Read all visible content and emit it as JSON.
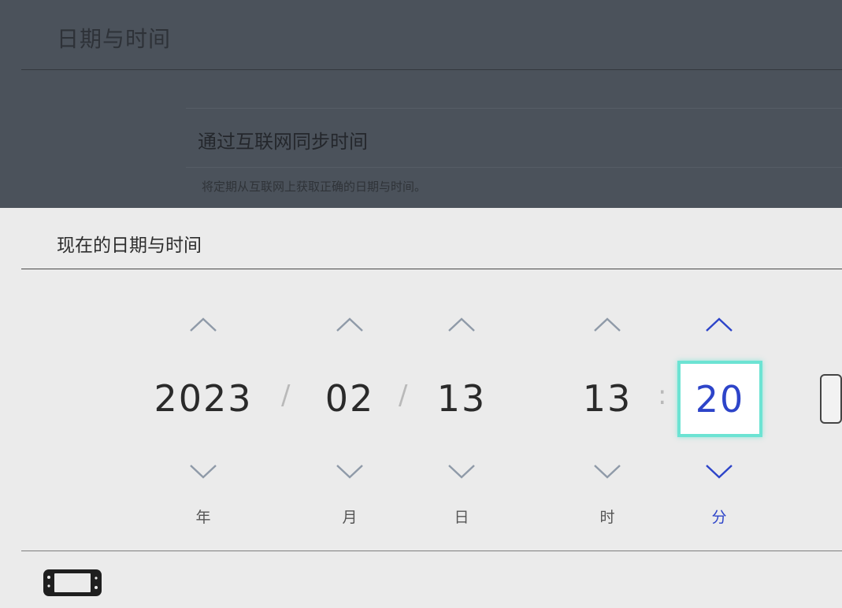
{
  "background": {
    "title": "日期与时间",
    "sync_row": {
      "label": "通过互联网同步时间",
      "description": "将定期从互联网上获取正确的日期与时间。"
    }
  },
  "sheet": {
    "title": "现在的日期与时间",
    "fields": {
      "year": {
        "value": "2023",
        "unit": "年"
      },
      "month": {
        "value": "02",
        "unit": "月"
      },
      "day": {
        "value": "13",
        "unit": "日"
      },
      "hour": {
        "value": "13",
        "unit": "时"
      },
      "minute": {
        "value": "20",
        "unit": "分"
      }
    },
    "separators": {
      "date": "/",
      "time": ":"
    },
    "active_field": "minute"
  },
  "icons": {
    "increment": "chevron-up-icon",
    "decrement": "chevron-down-icon",
    "console": "switch-console-icon"
  },
  "colors": {
    "accent": "#2d44c9",
    "focus_border": "#6ce3d3",
    "chevron": "#8f9aa8"
  }
}
